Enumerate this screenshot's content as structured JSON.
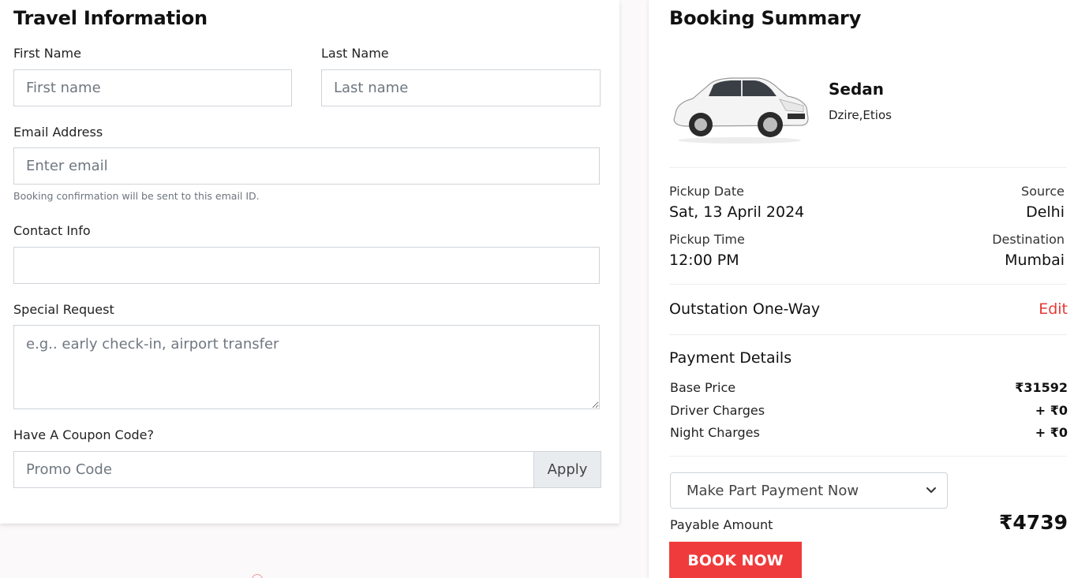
{
  "travel_info": {
    "title": "Travel Information",
    "first_name": {
      "label": "First Name",
      "placeholder": "First name",
      "value": ""
    },
    "last_name": {
      "label": "Last Name",
      "placeholder": "Last name",
      "value": ""
    },
    "email": {
      "label": "Email Address",
      "placeholder": "Enter email",
      "help": "Booking confirmation will be sent to this email ID.",
      "value": ""
    },
    "contact": {
      "label": "Contact Info",
      "placeholder": "",
      "value": ""
    },
    "special_request": {
      "label": "Special Request",
      "placeholder": "e.g.. early check-in, airport transfer",
      "value": ""
    },
    "coupon": {
      "label": "Have A Coupon Code?",
      "placeholder": "Promo Code",
      "value": "",
      "apply_label": "Apply"
    }
  },
  "summary": {
    "title": "Booking Summary",
    "car_name": "Sedan",
    "car_models": "Dzire,Etios",
    "pickup_date_label": "Pickup Date",
    "pickup_date": "Sat, 13 April 2024",
    "source_label": "Source",
    "source": "Delhi",
    "pickup_time_label": "Pickup Time",
    "pickup_time": "12:00 PM",
    "destination_label": "Destination",
    "destination": "Mumbai",
    "trip_type": "Outstation One-Way",
    "edit_label": "Edit",
    "payment_title": "Payment Details",
    "base_price_label": "Base Price",
    "base_price": "₹31592",
    "driver_charges_label": "Driver Charges",
    "driver_charges": "+ ₹0",
    "night_charges_label": "Night Charges",
    "night_charges": "+ ₹0",
    "payment_option": "Make Part Payment Now",
    "payable_label": "Payable Amount",
    "payable_amount": "₹4739",
    "book_label": "BOOK NOW"
  },
  "colors": {
    "accent": "#ef3b3b",
    "edit": "#e53935",
    "border": "#cfd4d9"
  }
}
